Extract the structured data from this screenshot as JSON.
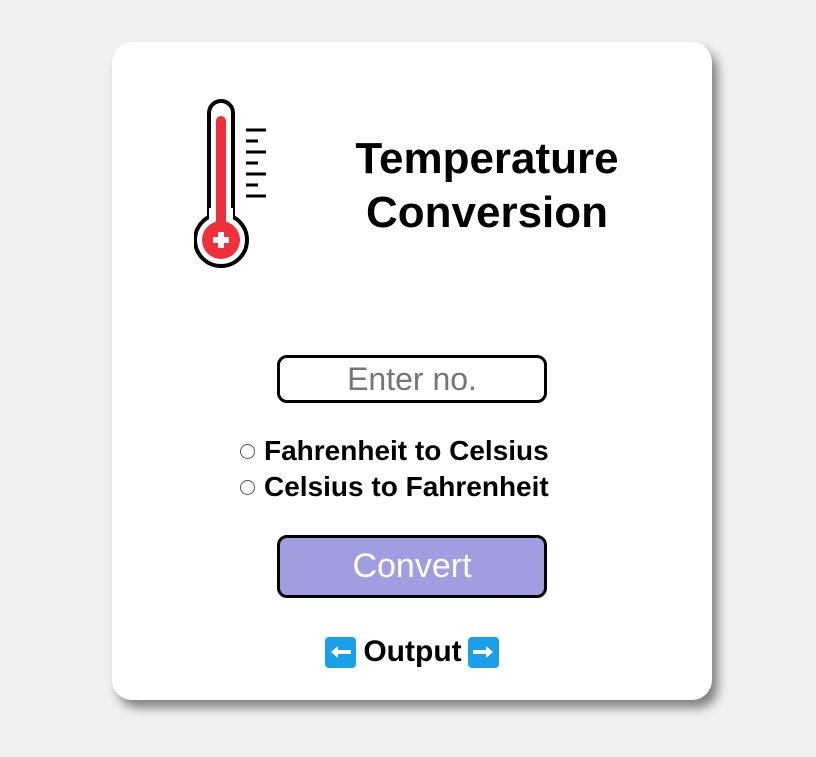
{
  "header": {
    "title_line1": "Temperature",
    "title_line2": "Conversion",
    "icon": "thermometer-icon"
  },
  "input": {
    "placeholder": "Enter no.",
    "value": ""
  },
  "options": [
    {
      "label": "Fahrenheit to Celsius",
      "selected": false
    },
    {
      "label": "Celsius to Fahrenheit",
      "selected": false
    }
  ],
  "convert_button": {
    "label": "Convert"
  },
  "output": {
    "label": "Output",
    "left_icon": "left-arrow-icon",
    "right_icon": "right-arrow-icon"
  },
  "colors": {
    "background": "#f0f0f0",
    "card": "#ffffff",
    "button": "#a09ee0",
    "thermometer_red": "#f0303a",
    "arrow_blue": "#1aa0e8"
  }
}
